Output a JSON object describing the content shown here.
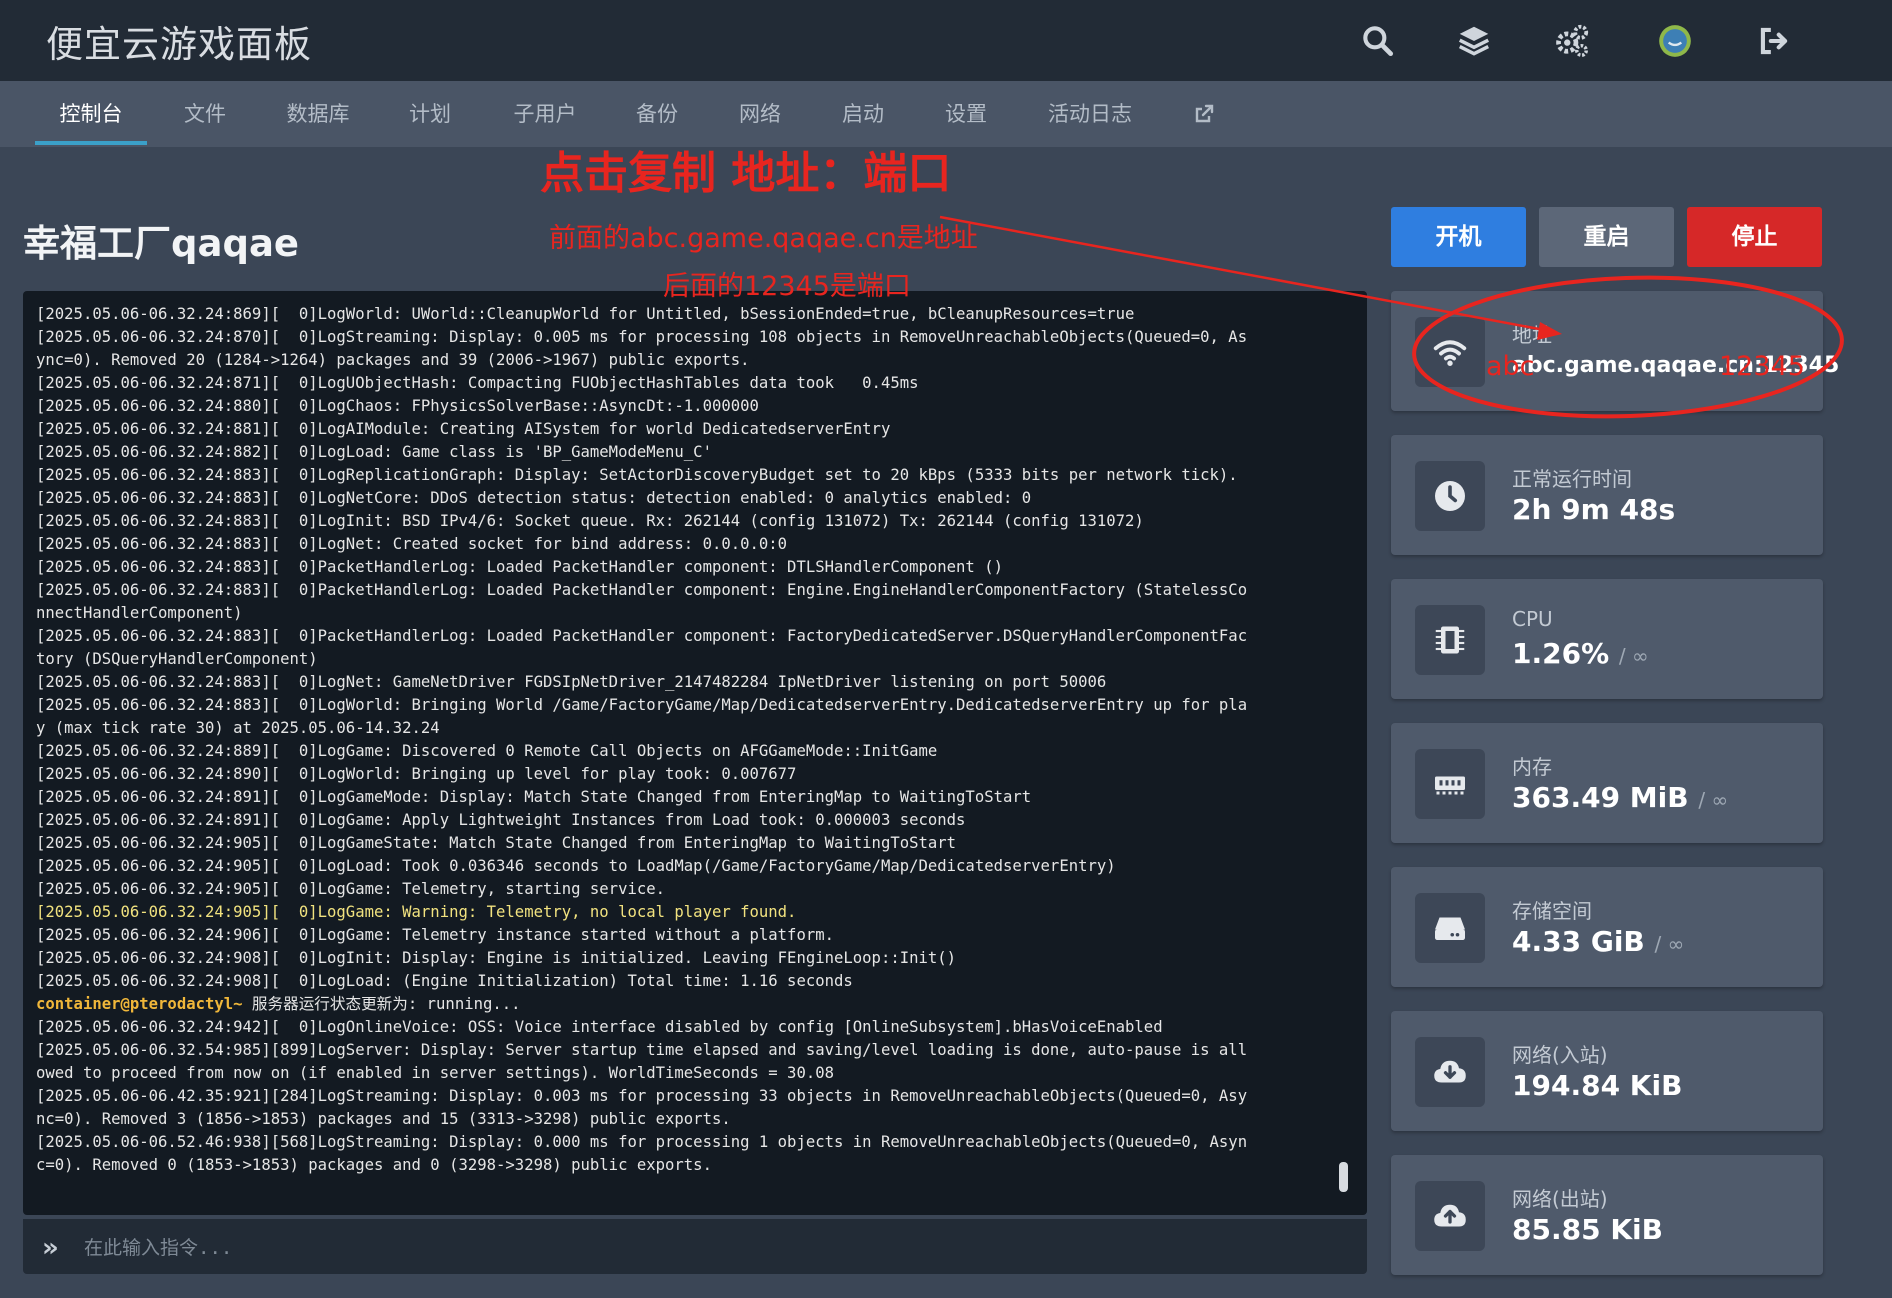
{
  "header": {
    "app_title": "便宜云游戏面板",
    "icons": [
      "search-icon",
      "layers-icon",
      "gears-icon",
      "avatar-icon",
      "logout-icon"
    ]
  },
  "tabs": [
    {
      "label": "控制台",
      "active": true
    },
    {
      "label": "文件"
    },
    {
      "label": "数据库"
    },
    {
      "label": "计划"
    },
    {
      "label": "子用户"
    },
    {
      "label": "备份"
    },
    {
      "label": "网络"
    },
    {
      "label": "启动"
    },
    {
      "label": "设置"
    },
    {
      "label": "活动日志"
    },
    {
      "label": "",
      "icon": "external-link-icon"
    }
  ],
  "server": {
    "title": "幸福工厂qaqae"
  },
  "actions": {
    "start": "开机",
    "restart": "重启",
    "stop": "停止"
  },
  "console": {
    "lines": [
      "[2025.05.06-06.32.24:869][  0]LogWorld: UWorld::CleanupWorld for Untitled, bSessionEnded=true, bCleanupResources=true",
      "[2025.05.06-06.32.24:870][  0]LogStreaming: Display: 0.005 ms for processing 108 objects in RemoveUnreachableObjects(Queued=0, As",
      "ync=0). Removed 20 (1284->1264) packages and 39 (2006->1967) public exports.",
      "[2025.05.06-06.32.24:871][  0]LogUObjectHash: Compacting FUObjectHashTables data took   0.45ms",
      "[2025.05.06-06.32.24:880][  0]LogChaos: FPhysicsSolverBase::AsyncDt:-1.000000",
      "[2025.05.06-06.32.24:881][  0]LogAIModule: Creating AISystem for world DedicatedserverEntry",
      "[2025.05.06-06.32.24:882][  0]LogLoad: Game class is 'BP_GameModeMenu_C'",
      "[2025.05.06-06.32.24:883][  0]LogReplicationGraph: Display: SetActorDiscoveryBudget set to 20 kBps (5333 bits per network tick).",
      "[2025.05.06-06.32.24:883][  0]LogNetCore: DDoS detection status: detection enabled: 0 analytics enabled: 0",
      "[2025.05.06-06.32.24:883][  0]LogInit: BSD IPv4/6: Socket queue. Rx: 262144 (config 131072) Tx: 262144 (config 131072)",
      "[2025.05.06-06.32.24:883][  0]LogNet: Created socket for bind address: 0.0.0.0:0",
      "[2025.05.06-06.32.24:883][  0]PacketHandlerLog: Loaded PacketHandler component: DTLSHandlerComponent ()",
      "[2025.05.06-06.32.24:883][  0]PacketHandlerLog: Loaded PacketHandler component: Engine.EngineHandlerComponentFactory (StatelessCo",
      "nnectHandlerComponent)",
      "[2025.05.06-06.32.24:883][  0]PacketHandlerLog: Loaded PacketHandler component: FactoryDedicatedServer.DSQueryHandlerComponentFac",
      "tory (DSQueryHandlerComponent)",
      "[2025.05.06-06.32.24:883][  0]LogNet: GameNetDriver FGDSIpNetDriver_2147482284 IpNetDriver listening on port 50006",
      "[2025.05.06-06.32.24:883][  0]LogWorld: Bringing World /Game/FactoryGame/Map/DedicatedserverEntry.DedicatedserverEntry up for pla",
      "y (max tick rate 30) at 2025.05.06-14.32.24",
      "[2025.05.06-06.32.24:889][  0]LogGame: Discovered 0 Remote Call Objects on AFGGameMode::InitGame",
      "[2025.05.06-06.32.24:890][  0]LogWorld: Bringing up level for play took: 0.007677",
      "[2025.05.06-06.32.24:891][  0]LogGameMode: Display: Match State Changed from EnteringMap to WaitingToStart",
      "[2025.05.06-06.32.24:891][  0]LogGame: Apply Lightweight Instances from Load took: 0.000003 seconds",
      "[2025.05.06-06.32.24:905][  0]LogGameState: Match State Changed from EnteringMap to WaitingToStart",
      "[2025.05.06-06.32.24:905][  0]LogLoad: Took 0.036346 seconds to LoadMap(/Game/FactoryGame/Map/DedicatedserverEntry)",
      "[2025.05.06-06.32.24:905][  0]LogGame: Telemetry, starting service.",
      "[2025.05.06-06.32.24:905][  0]LogGame: Warning: Telemetry, no local player found.",
      "[2025.05.06-06.32.24:906][  0]LogGame: Telemetry instance started without a platform.",
      "[2025.05.06-06.32.24:908][  0]LogInit: Display: Engine is initialized. Leaving FEngineLoop::Init()",
      "[2025.05.06-06.32.24:908][  0]LogLoad: (Engine Initialization) Total time: 1.16 seconds",
      "",
      "[2025.05.06-06.32.24:942][  0]LogOnlineVoice: OSS: Voice interface disabled by config [OnlineSubsystem].bHasVoiceEnabled",
      "[2025.05.06-06.32.54:985][899]LogServer: Display: Server startup time elapsed and saving/level loading is done, auto-pause is all",
      "owed to proceed from now on (if enabled in server settings). WorldTimeSeconds = 30.08",
      "[2025.05.06-06.42.35:921][284]LogStreaming: Display: 0.003 ms for processing 33 objects in RemoveUnreachableObjects(Queued=0, Asy",
      "nc=0). Removed 3 (1856->1853) packages and 15 (3313->3298) public exports.",
      "[2025.05.06-06.52.46:938][568]LogStreaming: Display: 0.000 ms for processing 1 objects in RemoveUnreachableObjects(Queued=0, Asyn",
      "c=0). Removed 0 (1853->1853) packages and 0 (3298->3298) public exports."
    ],
    "warning_line_index": 26,
    "prompt_line_index": 30,
    "prompt_user": "container@pterodactyl~",
    "prompt_text": " 服务器运行状态更新为: running...",
    "input_placeholder": "在此输入指令...",
    "warning_color": "#f1e27f",
    "prompt_color": "#f0b73a"
  },
  "stats": [
    {
      "label": "地址",
      "value": "abc.game.qaqae.cn:12345",
      "icon": "wifi-icon"
    },
    {
      "label": "正常运行时间",
      "value": "2h 9m 48s",
      "icon": "clock-icon"
    },
    {
      "label": "CPU",
      "value": "1.26%",
      "unit": "/ ∞",
      "icon": "cpu-chip-icon"
    },
    {
      "label": "内存",
      "value": "363.49 MiB",
      "unit": "/ ∞",
      "icon": "memory-icon"
    },
    {
      "label": "存储空间",
      "value": "4.33 GiB",
      "unit": "/ ∞",
      "icon": "hdd-icon"
    },
    {
      "label": "网络(入站)",
      "value": "194.84 KiB",
      "icon": "cloud-download-icon"
    },
    {
      "label": "网络(出站)",
      "value": "85.85 KiB",
      "icon": "cloud-upload-icon"
    }
  ],
  "annotations": {
    "headline": "点击复制 地址：端口",
    "line1": "前面的abc.game.qaqae.cn是地址",
    "line2": "后面的12345是端口",
    "overlay_abc": "abc",
    "overlay_port": "12345",
    "color": "#e8251f"
  },
  "colors": {
    "start": "#2f7ee0",
    "restart": "#5c6778",
    "stop": "#d62828",
    "tab_accent": "#3ba0c9"
  }
}
